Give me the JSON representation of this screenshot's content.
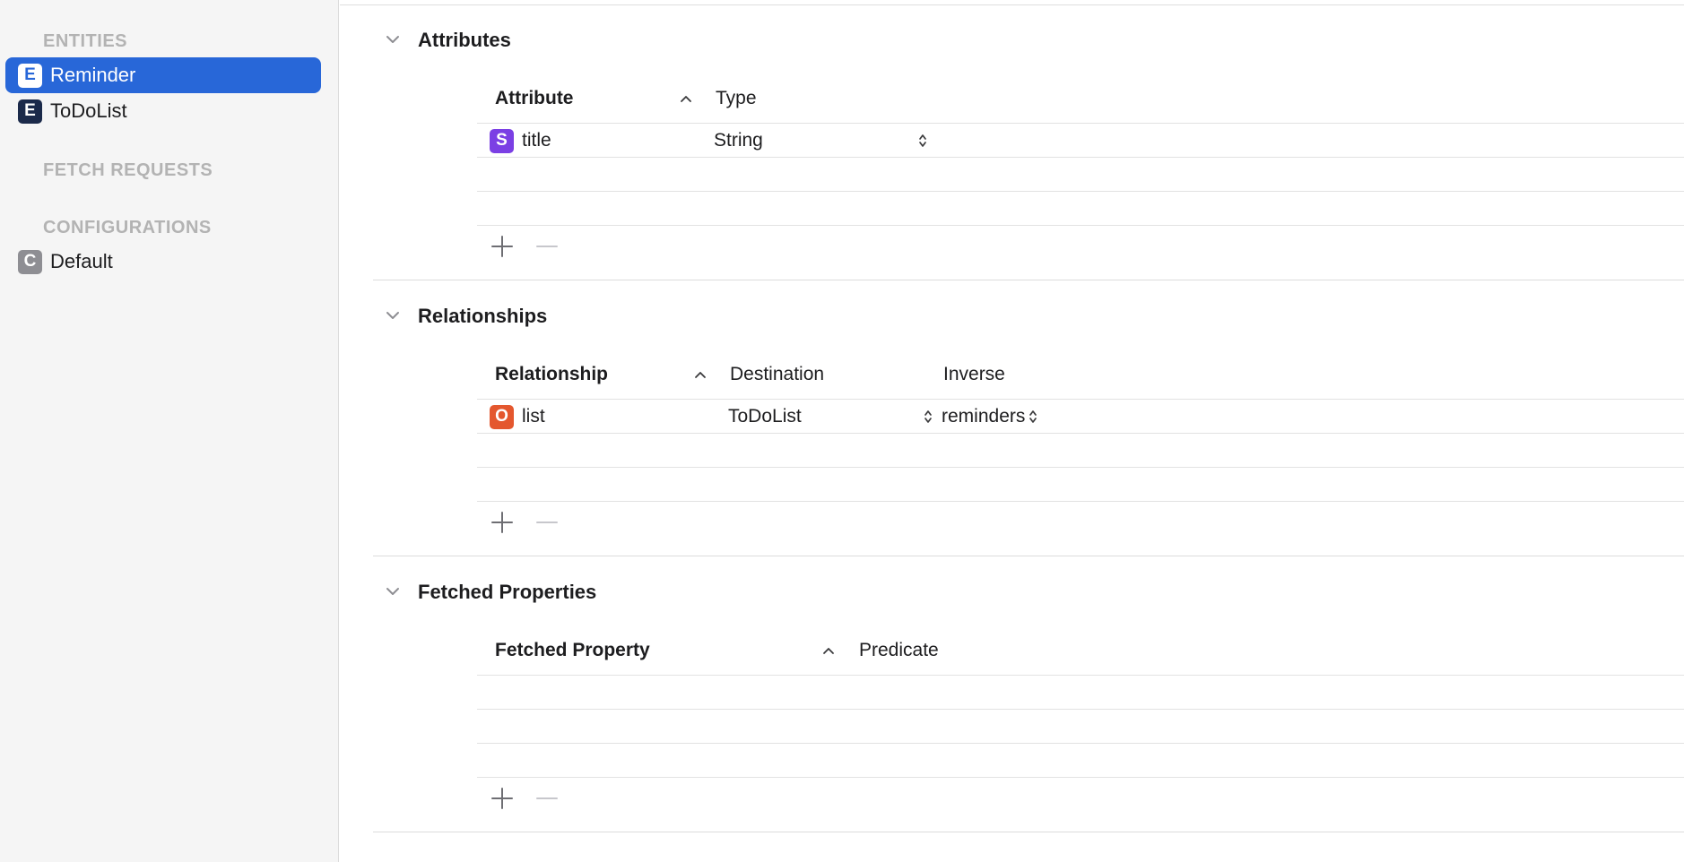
{
  "sidebar": {
    "entities_header": "ENTITIES",
    "entities": [
      {
        "badge": "E",
        "label": "Reminder",
        "selected": true
      },
      {
        "badge": "E",
        "label": "ToDoList",
        "selected": false
      }
    ],
    "fetch_requests_header": "FETCH REQUESTS",
    "configurations_header": "CONFIGURATIONS",
    "configurations": [
      {
        "badge": "C",
        "label": "Default"
      }
    ]
  },
  "attributes": {
    "title": "Attributes",
    "col_attribute": "Attribute",
    "col_type": "Type",
    "rows": [
      {
        "badge": "S",
        "name": "title",
        "type": "String"
      }
    ]
  },
  "relationships": {
    "title": "Relationships",
    "col_relationship": "Relationship",
    "col_destination": "Destination",
    "col_inverse": "Inverse",
    "rows": [
      {
        "badge": "O",
        "name": "list",
        "destination": "ToDoList",
        "inverse": "reminders"
      }
    ]
  },
  "fetched_properties": {
    "title": "Fetched Properties",
    "col_fetched_property": "Fetched Property",
    "col_predicate": "Predicate",
    "rows": []
  },
  "colors": {
    "selection": "#2867d8",
    "string_badge": "#7b3fe4",
    "relationship_badge": "#e4572e",
    "entity_badge": "#1b2a4a",
    "config_badge": "#8e8e93"
  },
  "icons": [
    "chevron-down-icon",
    "sort-ascending-icon",
    "add-icon",
    "remove-icon",
    "updown-arrows-icon"
  ]
}
